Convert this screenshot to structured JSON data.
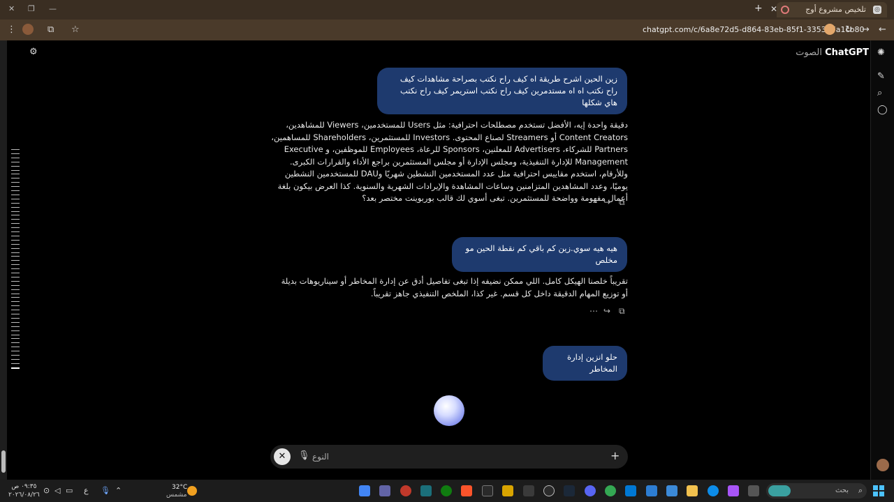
{
  "browser": {
    "tab_title": "تلخيص مشروع أوج",
    "url": "chatgpt.com/c/6a8e72d5-d864-83eb-85f1-335397a1cb80"
  },
  "app": {
    "brand": "ChatGPT",
    "mode": "الصوت"
  },
  "messages": [
    {
      "role": "user",
      "text": "زين الحين اشرح طريقة اه كيف راح نكتب بصراحة مشاهدات كيف راح نكتب اه اه مستدمرين كيف راح نكتب استريمر كيف راح نكتب هاي شكلها"
    },
    {
      "role": "assistant",
      "text": "دقيقة واحدة إيه، الأفضل تستخدم مصطلحات احترافية: مثل Users للمستخدمين، Viewers للمشاهدين، Content Creators أو Streamers لصناع المحتوى. Investors للمستثمرين، Shareholders للمساهمين، Partners للشركاء، Advertisers للمعلنين، Sponsors للرعاة، Employees للموظفين، و Executive Management للإدارة التنفيذية، ومجلس الإدارة أو مجلس المستثمرين براجع الأداء والقرارات الكبرى. وللأرقام، استخدم مقاييس احترافية مثل عدد المستخدمين النشطين شهريًا وDAU للمستخدمين النشطين يوميًا، وعدد المشاهدين المتزامنين وساعات المشاهدة والإيرادات الشهرية والسنوية. كذا العرض بيكون بلغة أعمال مفهومة وواضحة للمستثمرين. تبغى أسوي لك قالب بوربوينت مختصر بعد؟"
    },
    {
      "role": "user",
      "text": "هيه هيه سوي.زين كم باقي كم نقطة الحين مو مخلص"
    },
    {
      "role": "assistant",
      "text": "تقريباً خلصنا الهيكل كامل. اللي ممكن نضيفه إذا تبغى تفاصيل أدق عن إدارة المخاطر أو سيناريوهات بديلة أو توزيع المهام الدقيقة داخل كل قسم. غير كذا، الملخص التنفيذي جاهز تقريباً."
    },
    {
      "role": "user",
      "text": "حلو انزين إدارة المخاطر"
    }
  ],
  "composer": {
    "placeholder": "النوع"
  },
  "taskbar": {
    "time": "٠٩:٣٥ ص",
    "date": "٢٠٢٦/٠٨/٢٦",
    "temperature": "32°C",
    "weather": "مشمس",
    "search_label": "بحث",
    "lang": "ع"
  },
  "icons": {
    "accent": "#1e3a6e",
    "orb": "#8f9bf0"
  }
}
